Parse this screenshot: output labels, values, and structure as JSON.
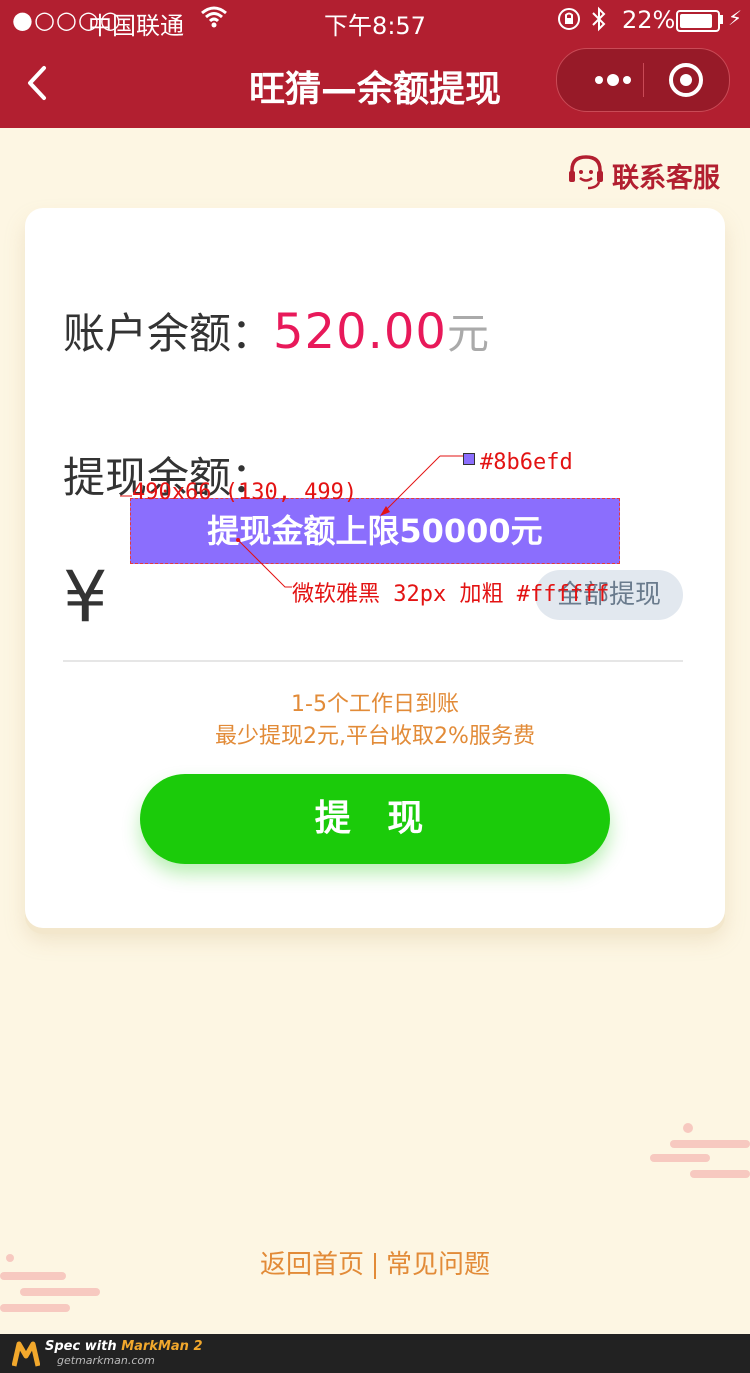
{
  "status_bar": {
    "signal": "●○○○○",
    "carrier": "中国联通",
    "time": "下午8:57",
    "battery": "22%"
  },
  "nav": {
    "title": "旺猜—余额提现"
  },
  "service": {
    "label": "联系客服"
  },
  "balance": {
    "label": "账户余额：",
    "value": "520.00",
    "unit": "元"
  },
  "withdraw": {
    "label": "提现余额：",
    "currency": "¥",
    "placeholder": "提现金额上限50000元",
    "all_button": "全部提现",
    "note_1": "1-5个工作日到账",
    "note_2": "最少提现2元,平台收取2%服务费",
    "submit": "提 现"
  },
  "spec": {
    "dimension": "490x66 (130, 499)",
    "color": "#8b6efd",
    "font": "微软雅黑 32px 加粗 #ffffff"
  },
  "links": {
    "home": "返回首页",
    "faq": "常见问题"
  },
  "watermark": {
    "line1_prefix": "Spec with ",
    "line1_brand": "MarkMan 2",
    "line2": "getmarkman.com"
  },
  "colors": {
    "brand_red": "#b21f30",
    "accent_pink": "#e8195a",
    "green": "#1bcb0a",
    "orange": "#e28b38",
    "input_bg": "#8b6efd"
  }
}
